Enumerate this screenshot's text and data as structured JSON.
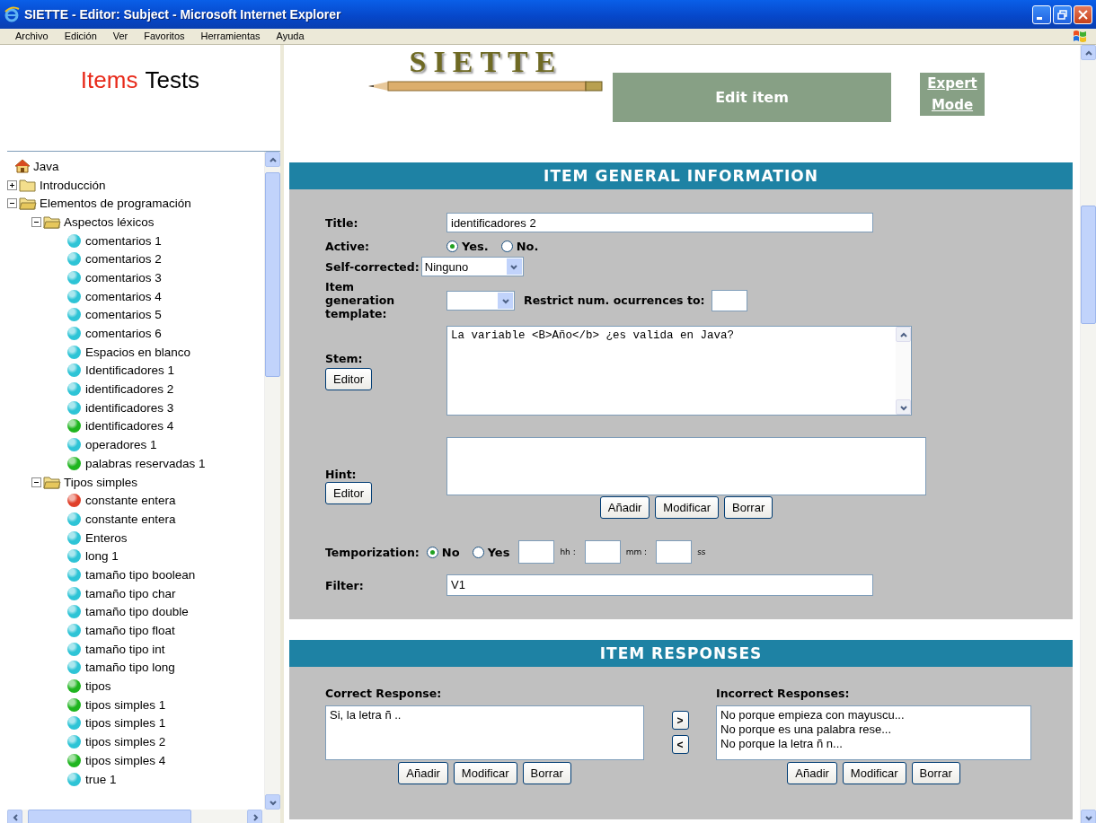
{
  "window": {
    "title": "SIETTE - Editor: Subject - Microsoft Internet Explorer"
  },
  "menu": [
    "Archivo",
    "Edición",
    "Ver",
    "Favoritos",
    "Herramientas",
    "Ayuda"
  ],
  "nav_tabs": [
    {
      "label": "Items",
      "selected": true
    },
    {
      "label": "Tests",
      "selected": false
    }
  ],
  "tree": {
    "label": "Java",
    "kind": "root",
    "children": [
      {
        "label": "Introducción",
        "kind": "folder",
        "expanded": false
      },
      {
        "label": "Elementos de programación",
        "kind": "folder",
        "expanded": true,
        "children": [
          {
            "label": "Aspectos léxicos",
            "kind": "folder",
            "expanded": true,
            "children": [
              {
                "label": "comentarios 1",
                "kind": "item",
                "color": "#2ec4d6"
              },
              {
                "label": "comentarios 2",
                "kind": "item",
                "color": "#2ec4d6"
              },
              {
                "label": "comentarios 3",
                "kind": "item",
                "color": "#2ec4d6"
              },
              {
                "label": "comentarios 4",
                "kind": "item",
                "color": "#2ec4d6"
              },
              {
                "label": "comentarios 5",
                "kind": "item",
                "color": "#2ec4d6"
              },
              {
                "label": "comentarios 6",
                "kind": "item",
                "color": "#2ec4d6"
              },
              {
                "label": "Espacios en blanco",
                "kind": "item",
                "color": "#2ec4d6"
              },
              {
                "label": "Identificadores 1",
                "kind": "item",
                "color": "#2ec4d6"
              },
              {
                "label": "identificadores 2",
                "kind": "item",
                "color": "#2ec4d6"
              },
              {
                "label": "identificadores 3",
                "kind": "item",
                "color": "#2ec4d6"
              },
              {
                "label": "identificadores 4",
                "kind": "item",
                "color": "#1fb51f"
              },
              {
                "label": "operadores 1",
                "kind": "item",
                "color": "#2ec4d6"
              },
              {
                "label": "palabras reservadas 1",
                "kind": "item",
                "color": "#1fb51f"
              }
            ]
          },
          {
            "label": "Tipos simples",
            "kind": "folder",
            "expanded": true,
            "children": [
              {
                "label": "constante entera",
                "kind": "item",
                "color": "#e0402a"
              },
              {
                "label": "constante entera",
                "kind": "item",
                "color": "#2ec4d6"
              },
              {
                "label": "Enteros",
                "kind": "item",
                "color": "#2ec4d6"
              },
              {
                "label": "long 1",
                "kind": "item",
                "color": "#2ec4d6"
              },
              {
                "label": "tamaño tipo boolean",
                "kind": "item",
                "color": "#2ec4d6"
              },
              {
                "label": "tamaño tipo char",
                "kind": "item",
                "color": "#2ec4d6"
              },
              {
                "label": "tamaño tipo double",
                "kind": "item",
                "color": "#2ec4d6"
              },
              {
                "label": "tamaño tipo float",
                "kind": "item",
                "color": "#2ec4d6"
              },
              {
                "label": "tamaño tipo int",
                "kind": "item",
                "color": "#2ec4d6"
              },
              {
                "label": "tamaño tipo long",
                "kind": "item",
                "color": "#2ec4d6"
              },
              {
                "label": "tipos",
                "kind": "item",
                "color": "#1fb51f"
              },
              {
                "label": "tipos simples 1",
                "kind": "item",
                "color": "#1fb51f"
              },
              {
                "label": "tipos simples 1",
                "kind": "item",
                "color": "#2ec4d6"
              },
              {
                "label": "tipos simples 2",
                "kind": "item",
                "color": "#2ec4d6"
              },
              {
                "label": "tipos simples 4",
                "kind": "item",
                "color": "#1fb51f"
              },
              {
                "label": "true 1",
                "kind": "item",
                "color": "#2ec4d6"
              }
            ]
          }
        ]
      }
    ]
  },
  "header": {
    "logo": "SIETTE",
    "page_title": "Edit item",
    "expert_mode": "Expert Mode"
  },
  "general": {
    "heading": "ITEM GENERAL INFORMATION",
    "title": {
      "label": "Title:",
      "value": "identificadores 2"
    },
    "active": {
      "label": "Active:",
      "options": [
        {
          "label": "Yes.",
          "selected": true
        },
        {
          "label": "No.",
          "selected": false
        }
      ]
    },
    "self_corrected": {
      "label": "Self-corrected:",
      "value": "Ninguno"
    },
    "template": {
      "label": "Item generation template:",
      "restrict_label": "Restrict num. ocurrences to:"
    },
    "stem": {
      "label": "Stem:",
      "editor_button": "Editor",
      "value": "La variable <B>Año</b> ¿es valida en Java?"
    },
    "hint": {
      "label": "Hint:",
      "editor_button": "Editor",
      "buttons": [
        "Añadir",
        "Modificar",
        "Borrar"
      ]
    },
    "temporization": {
      "label": "Temporization:",
      "options": [
        {
          "label": "No",
          "selected": true
        },
        {
          "label": "Yes",
          "selected": false
        }
      ],
      "units": [
        "hh :",
        "mm :",
        "ss"
      ]
    },
    "filter": {
      "label": "Filter:",
      "value": "V1"
    }
  },
  "responses": {
    "heading": "ITEM RESPONSES",
    "correct": {
      "label": "Correct Response:",
      "items": [
        "Si, la letra ñ .."
      ],
      "buttons": [
        "Añadir",
        "Modificar",
        "Borrar"
      ]
    },
    "move_buttons": [
      ">",
      "<"
    ],
    "incorrect": {
      "label": "Incorrect Responses:",
      "items": [
        "No porque empieza con mayuscu...",
        "No porque es una palabra rese...",
        "No porque la letra ñ n..."
      ],
      "buttons": [
        "Añadir",
        "Modificar",
        "Borrar"
      ]
    }
  }
}
